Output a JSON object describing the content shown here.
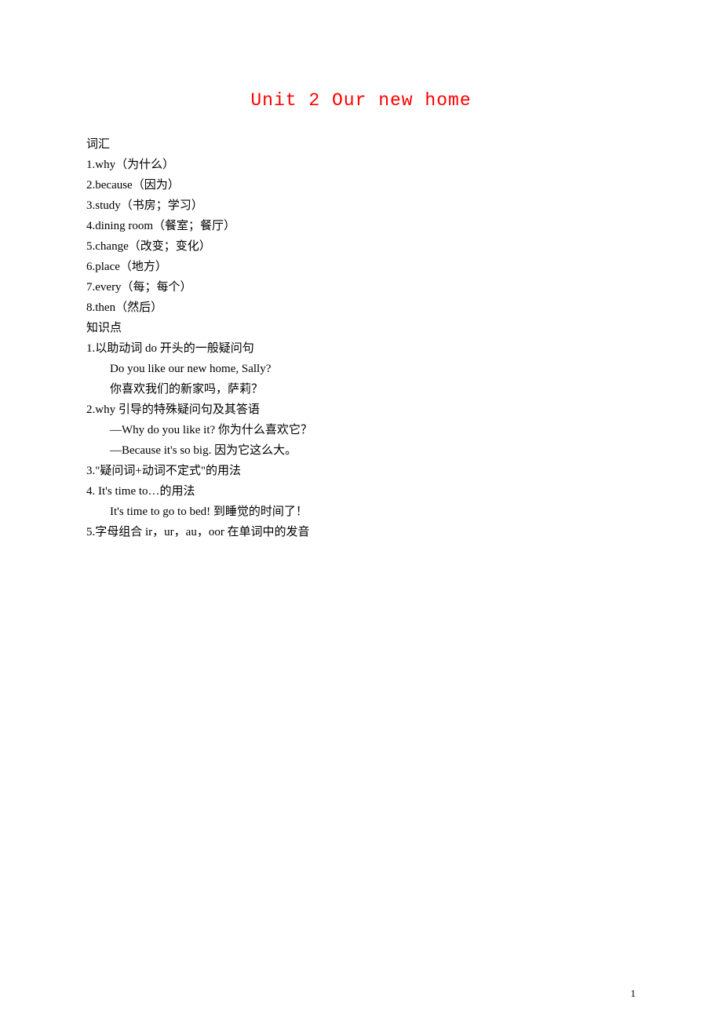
{
  "title": "Unit 2 Our new home",
  "sections": {
    "vocab_header": "词汇",
    "vocab": [
      "1.why（为什么）",
      "2.because（因为）",
      "3.study（书房；学习）",
      "4.dining room（餐室；餐厅）",
      "5.change（改变；变化）",
      "6.place（地方）",
      "7.every（每；每个）",
      "8.then（然后）"
    ],
    "knowledge_header": "知识点",
    "knowledge": [
      {
        "text": "1.以助动词 do 开头的一般疑问句",
        "indent": false
      },
      {
        "text": "Do you like our new home, Sally?",
        "indent": true
      },
      {
        "text": "你喜欢我们的新家吗，萨莉？",
        "indent": true
      },
      {
        "text": "2.why 引导的特殊疑问句及其答语",
        "indent": false
      },
      {
        "text": "—Why do you like it? 你为什么喜欢它？",
        "indent": true
      },
      {
        "text": "—Because it's so big. 因为它这么大。",
        "indent": true
      },
      {
        "text": "3.\"疑问词+动词不定式\"的用法",
        "indent": false
      },
      {
        "text": "4. It's time to…的用法",
        "indent": false
      },
      {
        "text": "It's time to go to bed! 到睡觉的时间了！",
        "indent": true
      },
      {
        "text": "5.字母组合 ir，ur，au，oor 在单词中的发音",
        "indent": false
      }
    ]
  },
  "page_number": "1"
}
